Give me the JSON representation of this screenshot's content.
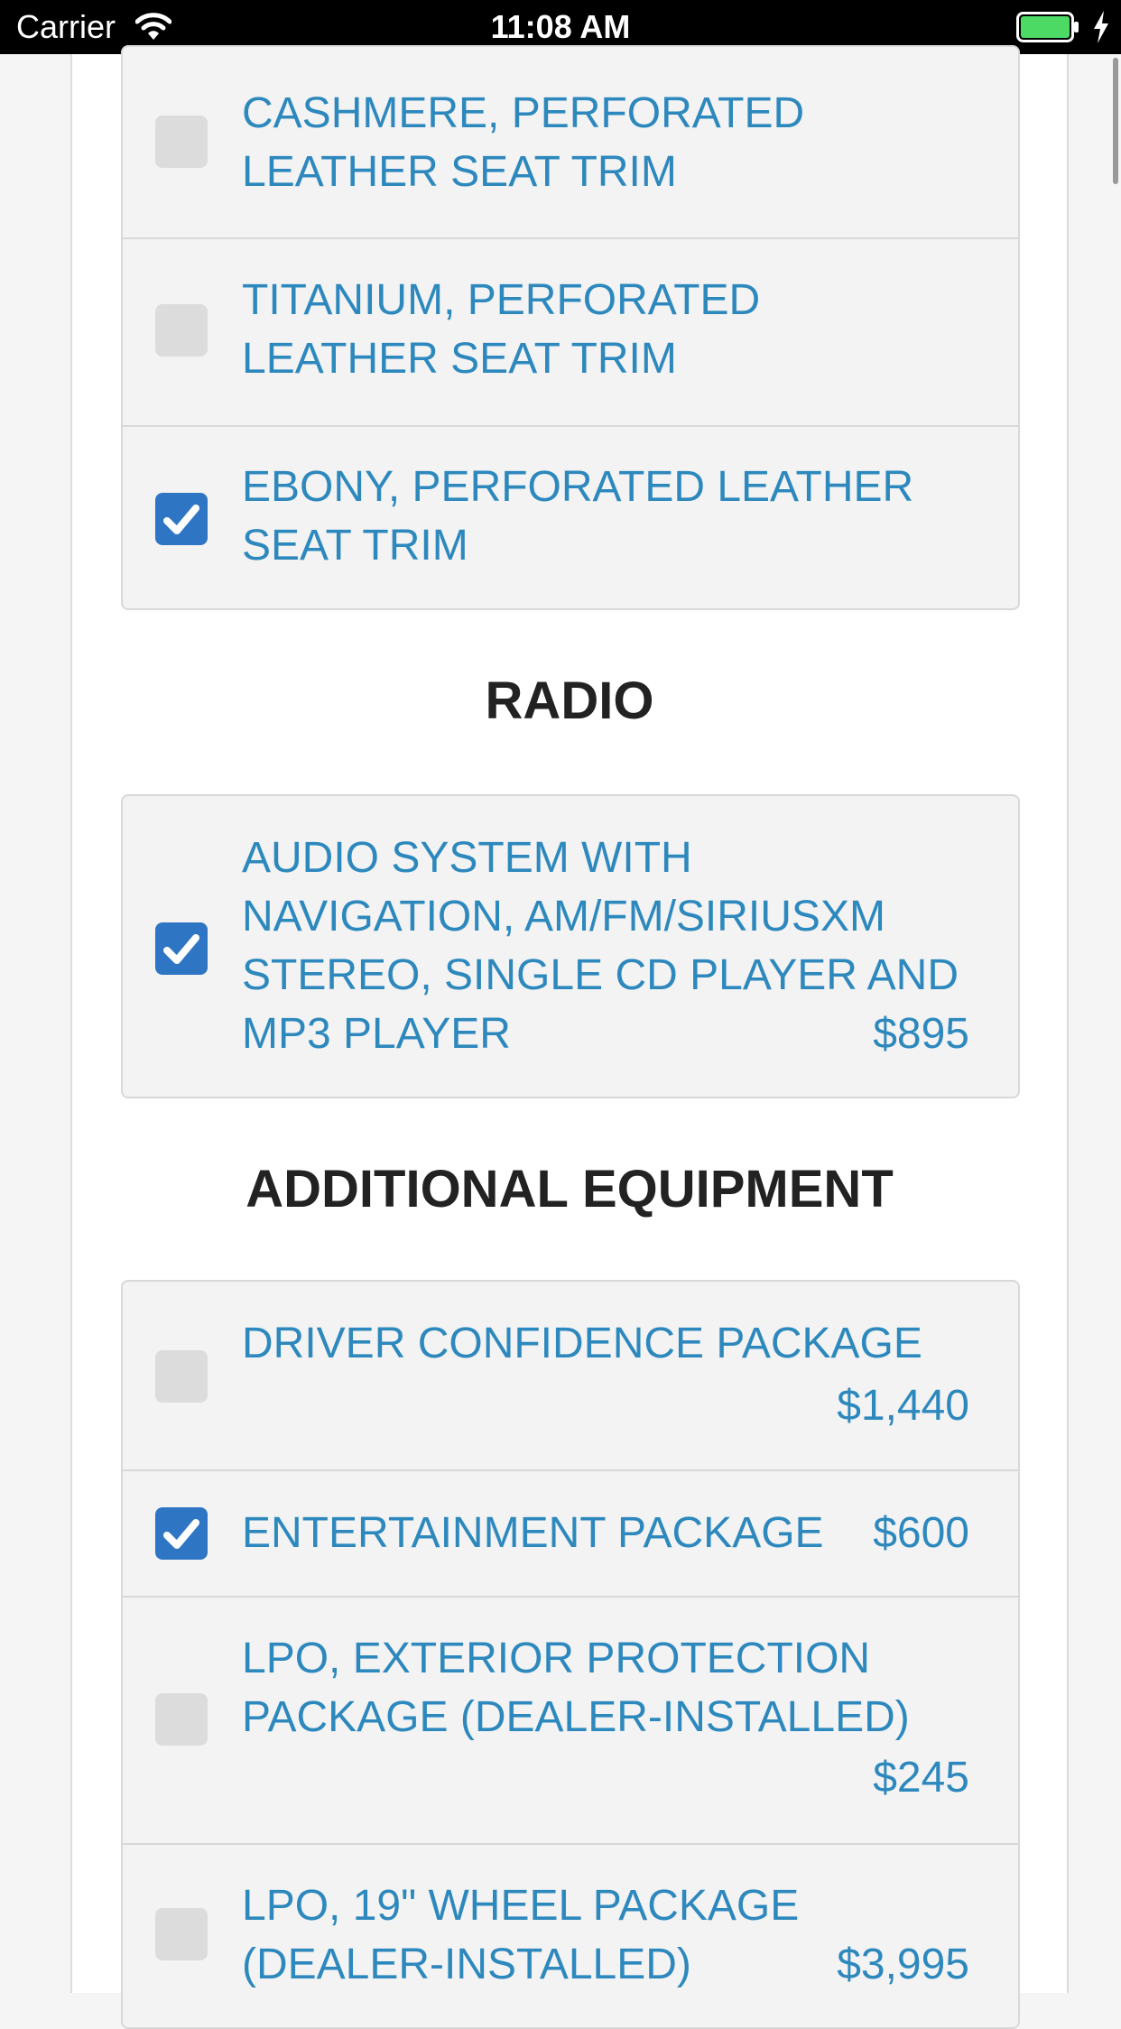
{
  "status_bar": {
    "carrier": "Carrier",
    "time": "11:08 AM",
    "battery_color": "#4cd964"
  },
  "colors": {
    "accent": "#2d88bd",
    "checkbox_checked": "#2e75c4",
    "checkbox_unchecked": "#dcdcdc",
    "heading": "#222222"
  },
  "seat_trim": {
    "options": [
      {
        "label": "CASHMERE, PERFORATED\nLEATHER SEAT TRIM",
        "checked": false
      },
      {
        "label": "TITANIUM, PERFORATED\nLEATHER SEAT TRIM",
        "checked": false
      },
      {
        "label": "EBONY, PERFORATED LEATHER\nSEAT TRIM",
        "checked": true
      }
    ]
  },
  "radio": {
    "heading": "RADIO",
    "options": [
      {
        "label": "AUDIO SYSTEM WITH\nNAVIGATION, AM/FM/SIRIUSXM\nSTEREO, SINGLE CD PLAYER AND\nMP3 PLAYER",
        "price": "$895",
        "checked": true
      }
    ]
  },
  "additional_equipment": {
    "heading": "ADDITIONAL EQUIPMENT",
    "options": [
      {
        "label": "DRIVER CONFIDENCE PACKAGE",
        "price": "$1,440",
        "checked": false
      },
      {
        "label": "ENTERTAINMENT PACKAGE",
        "price": "$600",
        "checked": true
      },
      {
        "label": "LPO, EXTERIOR PROTECTION\nPACKAGE (DEALER-INSTALLED)",
        "price": "$245",
        "checked": false
      },
      {
        "label": "LPO, 19\" WHEEL PACKAGE\n(DEALER-INSTALLED)",
        "price": "$3,995",
        "checked": false
      }
    ]
  },
  "icons": {
    "wifi": "wifi-icon",
    "battery": "battery-icon",
    "charging": "bolt-icon",
    "checkmark": "checkmark-icon"
  }
}
